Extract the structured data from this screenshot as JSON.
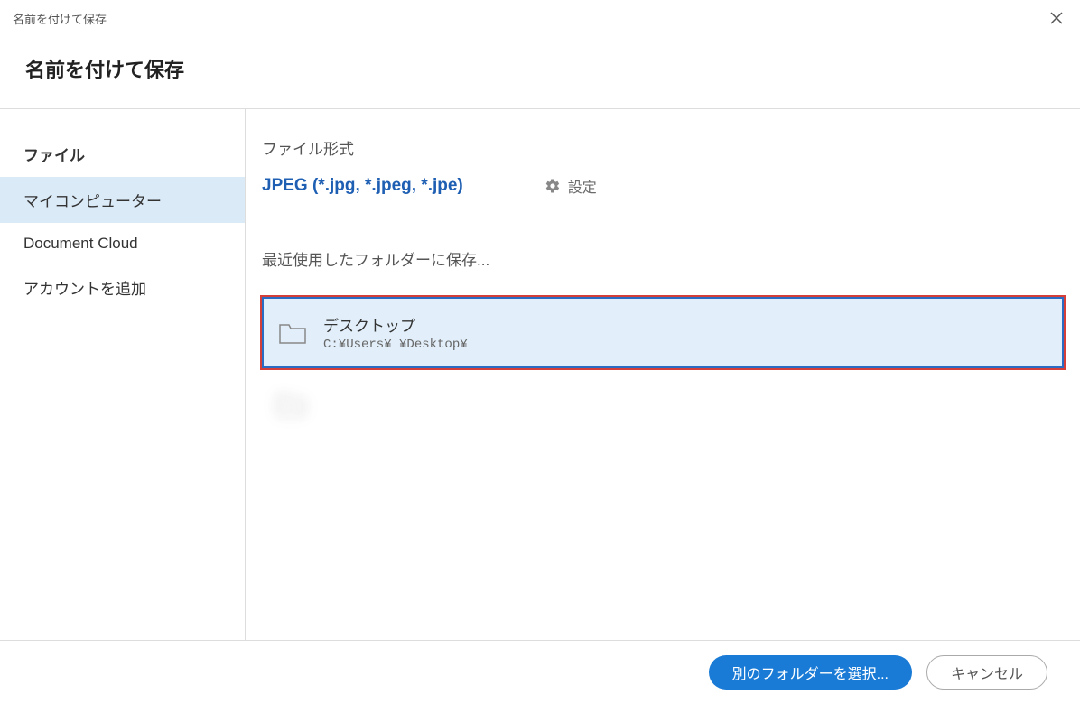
{
  "titlebar": {
    "title": "名前を付けて保存"
  },
  "header": {
    "title": "名前を付けて保存"
  },
  "sidebar": {
    "heading": "ファイル",
    "items": [
      {
        "label": "マイコンピューター",
        "selected": true
      },
      {
        "label": "Document Cloud",
        "selected": false
      },
      {
        "label": "アカウントを追加",
        "selected": false
      }
    ]
  },
  "main": {
    "format_label": "ファイル形式",
    "format_value": "JPEG (*.jpg, *.jpeg, *.jpe)",
    "settings_label": "設定",
    "recent_label": "最近使用したフォルダーに保存...",
    "folders": [
      {
        "name": "デスクトップ",
        "path": "C:¥Users¥     ¥Desktop¥",
        "highlighted": true
      },
      {
        "name": "　　　　　",
        "path": "　　　　　　　　　　　　　",
        "highlighted": false,
        "blurred": true
      }
    ]
  },
  "footer": {
    "choose_label": "別のフォルダーを選択...",
    "cancel_label": "キャンセル"
  }
}
